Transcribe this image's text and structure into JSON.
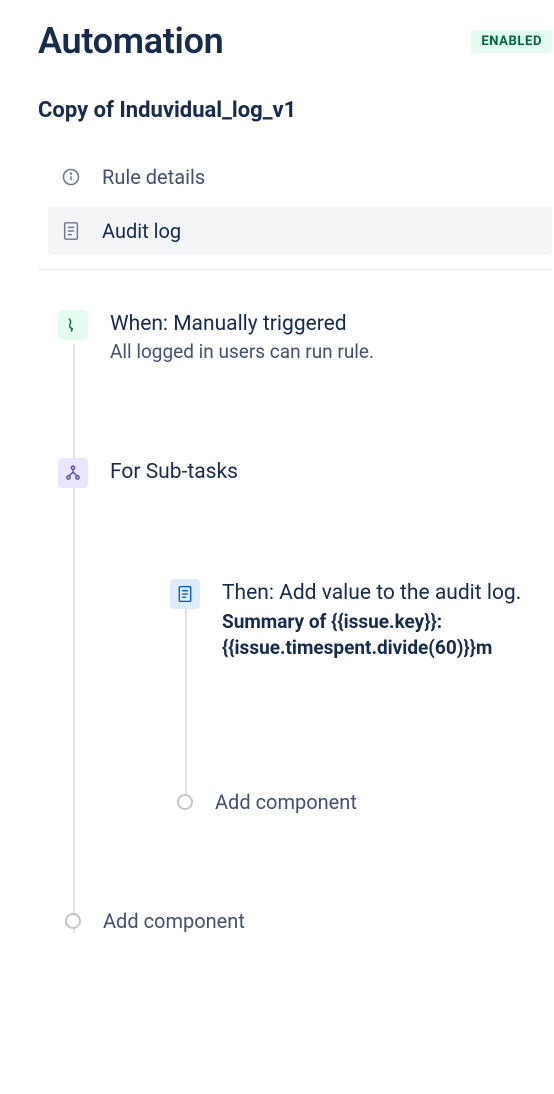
{
  "header": {
    "title": "Automation",
    "status_badge": "ENABLED"
  },
  "rule": {
    "name": "Copy of Induvidual_log_v1"
  },
  "nav": {
    "rule_details": "Rule details",
    "audit_log": "Audit log",
    "selected": "audit_log"
  },
  "flow": {
    "trigger": {
      "title": "When: Manually triggered",
      "subtitle": "All logged in users can run rule."
    },
    "branch": {
      "title": "For Sub-tasks"
    },
    "action": {
      "title": "Then: Add value to the audit log.",
      "body": "Summary of {{issue.key}}: {{issue.timespent.divide(60)}}m"
    },
    "add_component_inner": "Add component",
    "add_component_outer": "Add component"
  }
}
